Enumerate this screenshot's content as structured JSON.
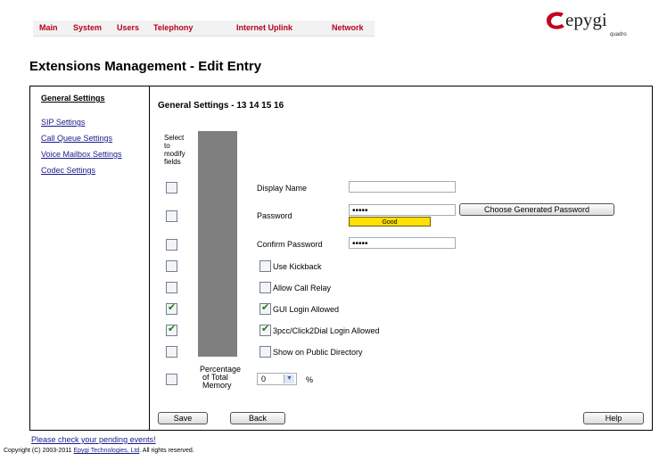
{
  "nav": [
    "Main",
    "System",
    "Users",
    "Telephony",
    "Internet Uplink",
    "Network"
  ],
  "logo": {
    "word": "epygi",
    "sub": "quadro"
  },
  "page_title": "Extensions Management - Edit Entry",
  "sidebar": [
    {
      "label": "General Settings",
      "active": true
    },
    {
      "label": "SIP Settings",
      "active": false
    },
    {
      "label": "Call Queue Settings",
      "active": false
    },
    {
      "label": "Voice Mailbox Settings",
      "active": false
    },
    {
      "label": "Codec Settings",
      "active": false
    }
  ],
  "content": {
    "title": "General Settings - 13 14 15 16",
    "select_header": [
      "Select",
      "to",
      "modify",
      "fields"
    ],
    "fields": {
      "display_name": {
        "label": "Display Name",
        "value": ""
      },
      "password": {
        "label": "Password",
        "value": "•••••",
        "strength": "Good"
      },
      "confirm_password": {
        "label": "Confirm Password",
        "value": "•••••"
      },
      "use_kickback": {
        "label": "Use Kickback",
        "checked": false
      },
      "allow_call_relay": {
        "label": "Allow Call Relay",
        "checked": false
      },
      "gui_login": {
        "label": "GUI Login Allowed",
        "checked": true
      },
      "click2dial": {
        "label": "3pcc/Click2Dial Login Allowed",
        "checked": true
      },
      "public_directory": {
        "label": "Show on Public Directory",
        "checked": false
      },
      "memory": {
        "label": [
          "Percentage",
          "of Total",
          "Memory"
        ],
        "value": "0",
        "unit": "%"
      }
    },
    "select_checks": [
      false,
      false,
      false,
      false,
      false,
      true,
      true,
      false,
      false
    ],
    "generate_password_button": "Choose Generated Password"
  },
  "buttons": {
    "save": "Save",
    "back": "Back",
    "help": "Help"
  },
  "footer": {
    "pending_events": "Please check your pending events!",
    "copyright_prefix": "Copyright (C) 2003-2011 ",
    "company": "Epygi Technologies, Ltd",
    "copyright_suffix": ". All rights reserved."
  }
}
